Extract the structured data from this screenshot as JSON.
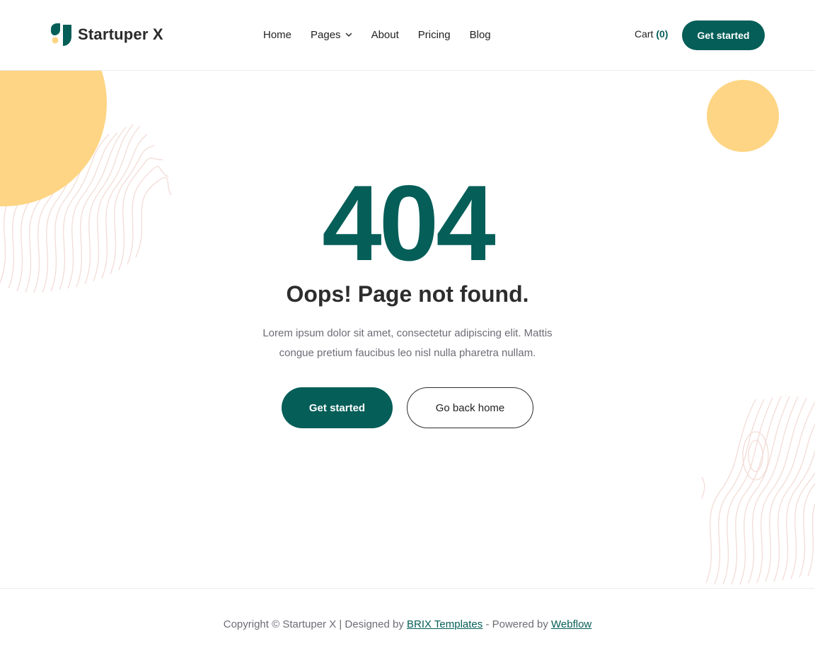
{
  "brand": {
    "name": "Startuper X",
    "colors": {
      "primary": "#055e58",
      "accent": "#fed584",
      "pattern": "#f3dcd6"
    }
  },
  "nav": {
    "items": [
      {
        "label": "Home"
      },
      {
        "label": "Pages",
        "icon": "chevron-down-icon"
      },
      {
        "label": "About"
      },
      {
        "label": "Pricing"
      },
      {
        "label": "Blog"
      }
    ],
    "cart_label": "Cart",
    "cart_count": "(0)",
    "cta_label": "Get started"
  },
  "main": {
    "code": "404",
    "title": "Oops! Page not found.",
    "description": "Lorem ipsum dolor sit amet, consectetur adipiscing elit. Mattis congue pretium faucibus leo nisl nulla pharetra nullam.",
    "primary_label": "Get started",
    "secondary_label": "Go back home"
  },
  "footer": {
    "prefix": "Copyright © Startuper X | Designed by",
    "designer_link": "BRIX Templates",
    "middle": " - Powered by ",
    "platform_link": "Webflow"
  }
}
